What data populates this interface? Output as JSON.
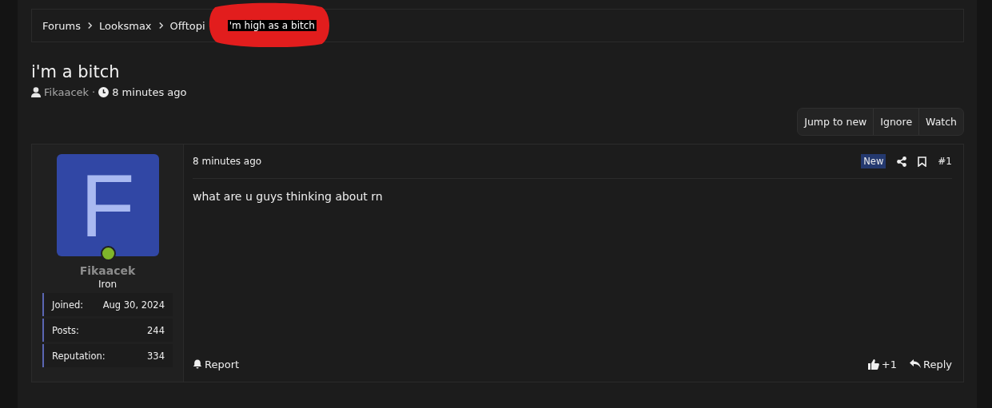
{
  "breadcrumbs": [
    {
      "label": "Forums"
    },
    {
      "label": "Looksmax"
    },
    {
      "label": "Offtopi"
    },
    {
      "label": "'m high as a bitch"
    }
  ],
  "thread": {
    "title": "i'm a bitch",
    "author": "Fikaacek",
    "separator": "·",
    "time": "8 minutes ago"
  },
  "actions": [
    "Jump to new",
    "Ignore",
    "Watch"
  ],
  "post": {
    "avatar_letter": "F",
    "online": true,
    "username": "Fikaacek",
    "rank": "Iron",
    "stats": [
      {
        "label": "Joined:",
        "value": "Aug 30, 2024"
      },
      {
        "label": "Posts:",
        "value": "244"
      },
      {
        "label": "Reputation:",
        "value": "334"
      }
    ],
    "time": "8 minutes ago",
    "badge": "New",
    "number": "#1",
    "body": "what are u guys thinking about rn",
    "report": "Report",
    "reactions": "+1",
    "reply": "Reply"
  }
}
